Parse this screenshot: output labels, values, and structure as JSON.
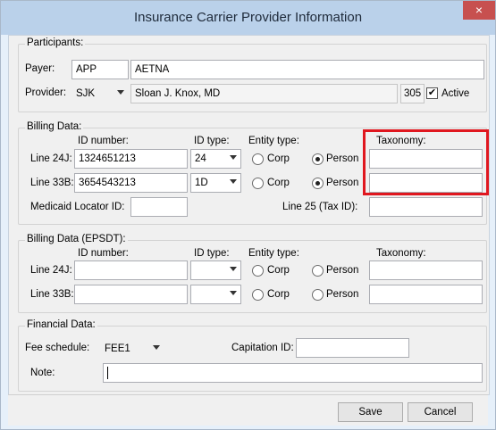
{
  "window": {
    "title": "Insurance Carrier Provider Information",
    "close_glyph": "×"
  },
  "participants": {
    "legend": "Participants:",
    "payer_label": "Payer:",
    "payer_code": "APP",
    "payer_name": "AETNA",
    "provider_label": "Provider:",
    "provider_code": "SJK",
    "provider_name": "Sloan J. Knox, MD",
    "provider_number": "305",
    "active_label": "Active",
    "active_checked": true
  },
  "billing": {
    "legend": "Billing Data:",
    "headers": {
      "id_number": "ID number:",
      "id_type": "ID type:",
      "entity_type": "Entity type:",
      "taxonomy": "Taxonomy:"
    },
    "rows": [
      {
        "label": "Line 24J:",
        "id_number": "1324651213",
        "id_type": "24",
        "corp": "Corp",
        "person": "Person",
        "selected": "person",
        "taxonomy": ""
      },
      {
        "label": "Line 33B:",
        "id_number": "3654543213",
        "id_type": "1D",
        "corp": "Corp",
        "person": "Person",
        "selected": "person",
        "taxonomy": ""
      }
    ],
    "medicaid_label": "Medicaid Locator ID:",
    "medicaid_value": "",
    "line25_label": "Line 25 (Tax ID):",
    "line25_value": ""
  },
  "epsdt": {
    "legend": "Billing Data (EPSDT):",
    "headers": {
      "id_number": "ID number:",
      "id_type": "ID type:",
      "entity_type": "Entity type:",
      "taxonomy": "Taxonomy:"
    },
    "rows": [
      {
        "label": "Line 24J:",
        "id_number": "",
        "id_type": "",
        "corp": "Corp",
        "person": "Person",
        "selected": "",
        "taxonomy": ""
      },
      {
        "label": "Line 33B:",
        "id_number": "",
        "id_type": "",
        "corp": "Corp",
        "person": "Person",
        "selected": "",
        "taxonomy": ""
      }
    ]
  },
  "financial": {
    "legend": "Financial Data:",
    "fee_label": "Fee schedule:",
    "fee_value": "FEE1",
    "capitation_label": "Capitation ID:",
    "capitation_value": "",
    "note_label": "Note:",
    "note_value": ""
  },
  "buttons": {
    "save_label": "Save",
    "cancel_label": "Cancel"
  },
  "colors": {
    "highlight": "#e0171f",
    "titlebar": "#bad1ea",
    "close": "#c7504f"
  }
}
